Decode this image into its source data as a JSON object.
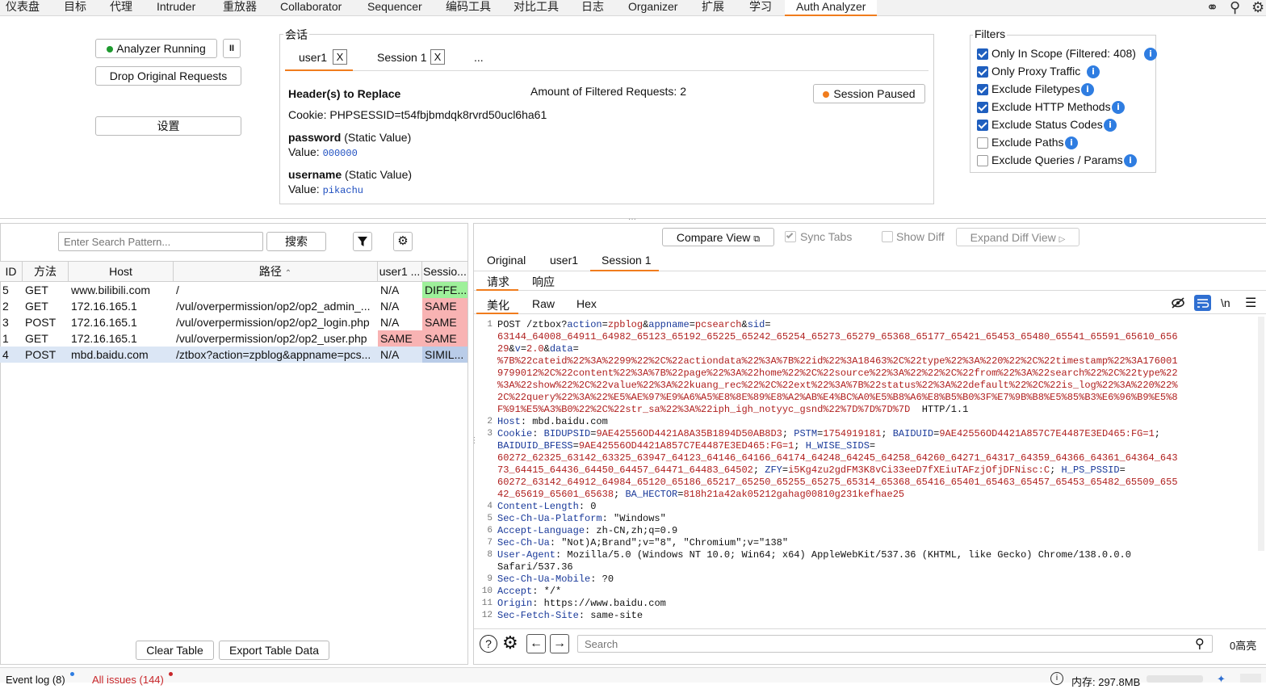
{
  "topbar": {
    "tabs": [
      "仪表盘",
      "目标",
      "代理",
      "Intruder",
      "重放器",
      "Collaborator",
      "Sequencer",
      "编码工具",
      "对比工具",
      "日志",
      "Organizer",
      "扩展",
      "学习",
      "Auth Analyzer"
    ]
  },
  "controls": {
    "analyzer_running": "Analyzer Running",
    "pause": "II",
    "drop_original": "Drop Original Requests",
    "settings": "设置"
  },
  "session": {
    "legend": "会话",
    "tabs": [
      {
        "label": "user1",
        "close": "X"
      },
      {
        "label": "Session 1",
        "close": "X"
      },
      {
        "label": "..."
      }
    ],
    "headers_title": "Header(s) to Replace",
    "filtered_count": "Amount of Filtered Requests: 2",
    "session_paused": "Session Paused",
    "cookie": "Cookie: PHPSESSID=t54fbjbmdqk8rvrd50ucl6ha61",
    "params": [
      {
        "name": "password",
        "kind": "(Static Value)",
        "value_label": "Value:",
        "value": "000000"
      },
      {
        "name": "username",
        "kind": "(Static Value)",
        "value_label": "Value:",
        "value": "pikachu"
      }
    ]
  },
  "filters": {
    "legend": "Filters",
    "items": [
      {
        "label": "Only In Scope (Filtered: 408)",
        "checked": true
      },
      {
        "label": "Only Proxy Traffic",
        "checked": true
      },
      {
        "label": "Exclude Filetypes",
        "checked": true
      },
      {
        "label": "Exclude HTTP Methods",
        "checked": true
      },
      {
        "label": "Exclude Status Codes",
        "checked": true
      },
      {
        "label": "Exclude Paths",
        "checked": false
      },
      {
        "label": "Exclude Queries / Params",
        "checked": false
      }
    ]
  },
  "search": {
    "placeholder": "Enter Search Pattern...",
    "button": "搜索"
  },
  "table": {
    "columns": [
      "ID",
      "方法",
      "Host",
      "路径",
      "user1 ...",
      "Sessio..."
    ],
    "rows": [
      {
        "id": "5",
        "method": "GET",
        "host": "www.bilibili.com",
        "path": "/",
        "user1": "N/A",
        "session": "DIFFE..."
      },
      {
        "id": "2",
        "method": "GET",
        "host": "172.16.165.1",
        "path": "/vul/overpermission/op2/op2_admin_...",
        "user1": "N/A",
        "session": "SAME"
      },
      {
        "id": "3",
        "method": "POST",
        "host": "172.16.165.1",
        "path": "/vul/overpermission/op2/op2_login.php",
        "user1": "N/A",
        "session": "SAME"
      },
      {
        "id": "1",
        "method": "GET",
        "host": "172.16.165.1",
        "path": "/vul/overpermission/op2/op2_user.php",
        "user1": "SAME",
        "session": "SAME"
      },
      {
        "id": "4",
        "method": "POST",
        "host": "mbd.baidu.com",
        "path": "/ztbox?action=zpblog&appname=pcs...",
        "user1": "N/A",
        "session": "SIMIL..."
      }
    ],
    "clear_button": "Clear Table",
    "export_button": "Export Table Data"
  },
  "viewer": {
    "compare_view": "Compare View",
    "sync_tabs": "Sync Tabs",
    "show_diff": "Show Diff",
    "expand_diff": "Expand Diff View",
    "tabs": [
      "Original",
      "user1",
      "Session 1"
    ],
    "subtabs": [
      "请求",
      "响应"
    ],
    "modes": [
      "美化",
      "Raw",
      "Hex"
    ],
    "newline_symbol": "\\n",
    "search_placeholder": "Search",
    "highlights": "0高亮"
  },
  "request_lines": [
    {
      "n": "1",
      "segs": [
        [
          "",
          "POST /ztbox?"
        ],
        [
          "k",
          "action"
        ],
        [
          "",
          "="
        ],
        [
          "v",
          "zpblog"
        ],
        [
          "",
          "&"
        ],
        [
          "k",
          "appname"
        ],
        [
          "",
          "="
        ],
        [
          "v",
          "pcsearch"
        ],
        [
          "",
          "&"
        ],
        [
          "k",
          "sid"
        ],
        [
          "",
          "="
        ]
      ]
    },
    {
      "n": "",
      "segs": [
        [
          "v",
          "63144_64008_64911_64982_65123_65192_65225_65242_65254_65273_65279_65368_65177_65421_65453_65480_65541_65591_65610_656"
        ]
      ]
    },
    {
      "n": "",
      "segs": [
        [
          "v",
          "29"
        ],
        [
          "",
          "&"
        ],
        [
          "k",
          "v"
        ],
        [
          "",
          "="
        ],
        [
          "v",
          "2.0"
        ],
        [
          "",
          "&"
        ],
        [
          "k",
          "data"
        ],
        [
          "",
          "="
        ]
      ]
    },
    {
      "n": "",
      "segs": [
        [
          "v",
          "%7B%22cateid%22%3A%2299%22%2C%22actiondata%22%3A%7B%22id%22%3A18463%2C%22type%22%3A%220%22%2C%22timestamp%22%3A176001"
        ]
      ]
    },
    {
      "n": "",
      "segs": [
        [
          "v",
          "9799012%2C%22content%22%3A%7B%22page%22%3A%22home%22%2C%22source%22%3A%22%22%2C%22from%22%3A%22search%22%2C%22type%22"
        ]
      ]
    },
    {
      "n": "",
      "segs": [
        [
          "v",
          "%3A%22show%22%2C%22value%22%3A%22kuang_rec%22%2C%22ext%22%3A%7B%22status%22%3A%22default%22%2C%22is_log%22%3A%220%22%"
        ]
      ]
    },
    {
      "n": "",
      "segs": [
        [
          "v",
          "2C%22query%22%3A%22%E5%AE%97%E9%A6%A5%E8%8E%89%E8%A2%AB%E4%BC%A0%E5%B8%A6%E8%B5%B0%3F%E7%9B%B8%E5%85%B3%E6%96%B9%E5%8"
        ]
      ]
    },
    {
      "n": "",
      "segs": [
        [
          "v",
          "F%91%E5%A3%B0%22%2C%22str_sa%22%3A%22iph_igh_notyyc_gsnd%22%7D%7D%7D%7D"
        ],
        [
          "",
          "  HTTP/1.1"
        ]
      ]
    },
    {
      "n": "2",
      "segs": [
        [
          "hdrk",
          "Host"
        ],
        [
          "",
          ": mbd.baidu.com"
        ]
      ]
    },
    {
      "n": "3",
      "segs": [
        [
          "hdrk",
          "Cookie"
        ],
        [
          "",
          ": "
        ],
        [
          "k",
          "BIDUPSID"
        ],
        [
          "",
          "="
        ],
        [
          "v",
          "9AE42556OD4421A8A35B1894D50AB8D3"
        ],
        [
          "",
          "; "
        ],
        [
          "k",
          "PSTM"
        ],
        [
          "",
          "="
        ],
        [
          "v",
          "1754919181"
        ],
        [
          "",
          "; "
        ],
        [
          "k",
          "BAIDUID"
        ],
        [
          "",
          "="
        ],
        [
          "v",
          "9AE42556OD4421A857C7E4487E3ED465:FG=1"
        ],
        [
          "",
          ";"
        ]
      ]
    },
    {
      "n": "",
      "segs": [
        [
          "k",
          "BAIDUID_BFESS"
        ],
        [
          "",
          "="
        ],
        [
          "v",
          "9AE42556OD4421A857C7E4487E3ED465:FG=1"
        ],
        [
          "",
          "; "
        ],
        [
          "k",
          "H_WISE_SIDS"
        ],
        [
          "",
          "="
        ]
      ]
    },
    {
      "n": "",
      "segs": [
        [
          "v",
          "60272_62325_63142_63325_63947_64123_64146_64166_64174_64248_64245_64258_64260_64271_64317_64359_64366_64361_64364_643"
        ]
      ]
    },
    {
      "n": "",
      "segs": [
        [
          "v",
          "73_64415_64436_64450_64457_64471_64483_64502"
        ],
        [
          "",
          "; "
        ],
        [
          "k",
          "ZFY"
        ],
        [
          "",
          "="
        ],
        [
          "v",
          "i5Kg4zu2gdFM3K8vCi33eeD7fXEiuTAFzjOfjDFNisc:C"
        ],
        [
          "",
          "; "
        ],
        [
          "k",
          "H_PS_PSSID"
        ],
        [
          "",
          "="
        ]
      ]
    },
    {
      "n": "",
      "segs": [
        [
          "v",
          "60272_63142_64912_64984_65120_65186_65217_65250_65255_65275_65314_65368_65416_65401_65463_65457_65453_65482_65509_655"
        ]
      ]
    },
    {
      "n": "",
      "segs": [
        [
          "v",
          "42_65619_65601_65638"
        ],
        [
          "",
          "; "
        ],
        [
          "k",
          "BA_HECTOR"
        ],
        [
          "",
          "="
        ],
        [
          "v",
          "818h21a42ak05212gahag00810g231kefhae25"
        ]
      ]
    },
    {
      "n": "4",
      "segs": [
        [
          "hdrk",
          "Content-Length"
        ],
        [
          "",
          ": 0"
        ]
      ]
    },
    {
      "n": "5",
      "segs": [
        [
          "hdrk",
          "Sec-Ch-Ua-Platform"
        ],
        [
          "",
          ": \"Windows\""
        ]
      ]
    },
    {
      "n": "6",
      "segs": [
        [
          "hdrk",
          "Accept-Language"
        ],
        [
          "",
          ": zh-CN,zh;q=0.9"
        ]
      ]
    },
    {
      "n": "7",
      "segs": [
        [
          "hdrk",
          "Sec-Ch-Ua"
        ],
        [
          "",
          ": \"Not)A;Brand\";v=\"8\", \"Chromium\";v=\"138\""
        ]
      ]
    },
    {
      "n": "8",
      "segs": [
        [
          "hdrk",
          "User-Agent"
        ],
        [
          "",
          ": Mozilla/5.0 (Windows NT 10.0; Win64; x64) AppleWebKit/537.36 (KHTML, like Gecko) Chrome/138.0.0.0"
        ]
      ]
    },
    {
      "n": "",
      "segs": [
        [
          "",
          "Safari/537.36"
        ]
      ]
    },
    {
      "n": "9",
      "segs": [
        [
          "hdrk",
          "Sec-Ch-Ua-Mobile"
        ],
        [
          "",
          ": ?0"
        ]
      ]
    },
    {
      "n": "10",
      "segs": [
        [
          "hdrk",
          "Accept"
        ],
        [
          "",
          ": */*"
        ]
      ]
    },
    {
      "n": "11",
      "segs": [
        [
          "hdrk",
          "Origin"
        ],
        [
          "",
          ": https://www.baidu.com"
        ]
      ]
    },
    {
      "n": "12",
      "segs": [
        [
          "hdrk",
          "Sec-Fetch-Site"
        ],
        [
          "",
          ": same-site"
        ]
      ]
    }
  ],
  "statusbar": {
    "event_log": "Event log (8)",
    "all_issues": "All issues (144)",
    "memory": "内存: 297.8MB"
  },
  "colors": {
    "accent_orange": "#f07c1d",
    "running_green": "#1e9a2f",
    "diff_green": "#9ef09a",
    "same_red": "#f8b3b3",
    "similar_blue": "#b9cce8",
    "row_selected": "#dbe6f5"
  }
}
